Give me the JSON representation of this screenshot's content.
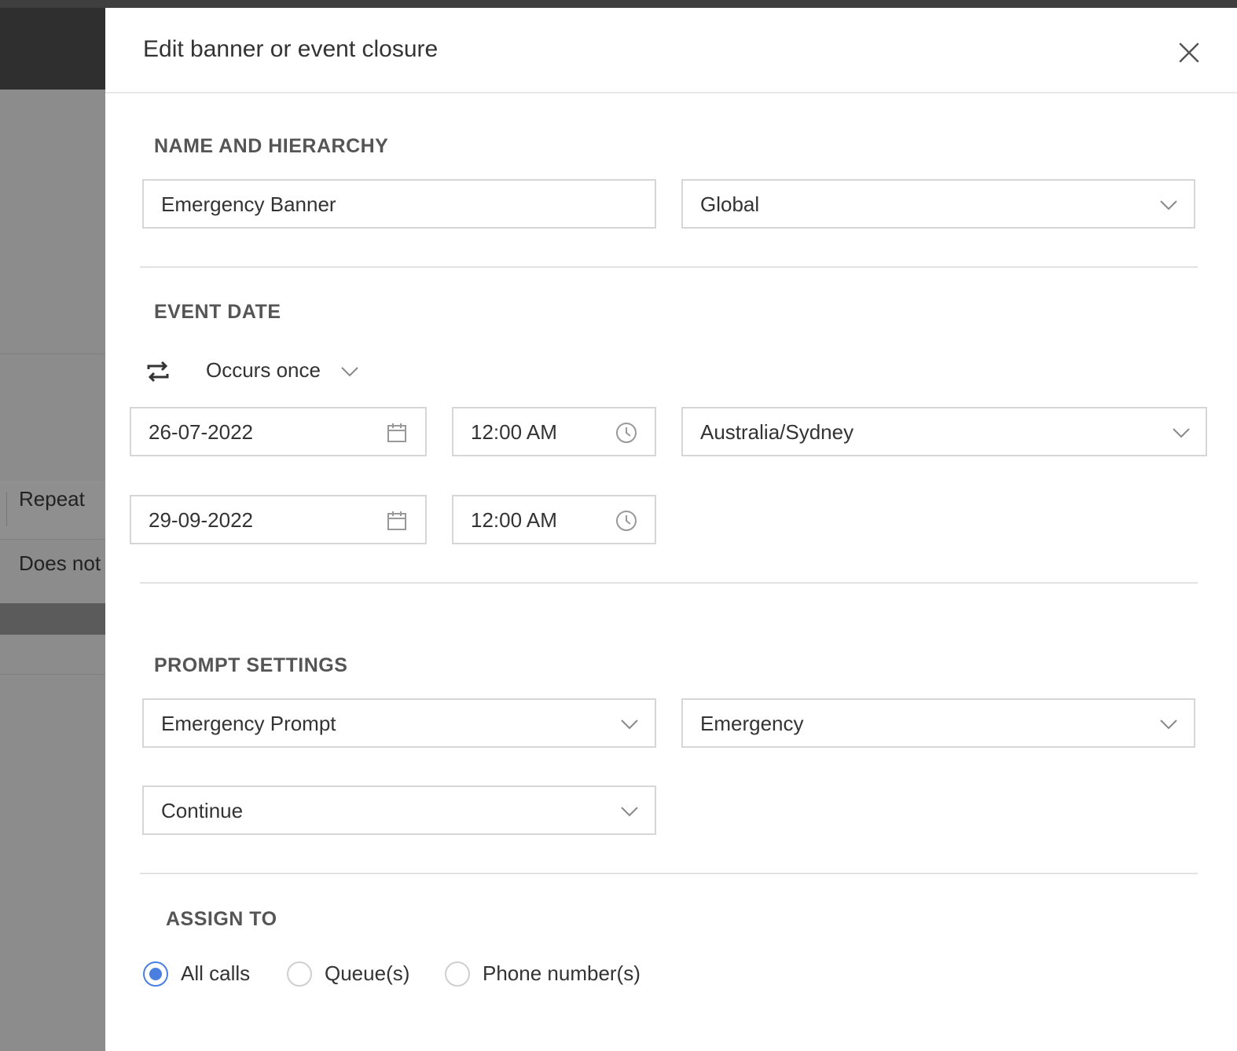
{
  "background": {
    "repeat_label": "Repeat",
    "does_not_label": "Does not"
  },
  "drawer": {
    "title": "Edit banner or event closure"
  },
  "name_hierarchy": {
    "section_title": "NAME AND HIERARCHY",
    "name_value": "Emergency Banner",
    "hierarchy_value": "Global"
  },
  "event_date": {
    "section_title": "EVENT DATE",
    "recurrence_value": "Occurs once",
    "start_date": "26-07-2022",
    "start_time": "12:00 AM",
    "timezone": "Australia/Sydney",
    "end_date": "29-09-2022",
    "end_time": "12:00 AM"
  },
  "prompt_settings": {
    "section_title": "PROMPT SETTINGS",
    "prompt_value": "Emergency Prompt",
    "prompt_type_value": "Emergency",
    "action_value": "Continue"
  },
  "assign_to": {
    "section_title": "ASSIGN TO",
    "options": [
      {
        "label": "All calls",
        "selected": true
      },
      {
        "label": "Queue(s)",
        "selected": false
      },
      {
        "label": "Phone number(s)",
        "selected": false
      }
    ]
  },
  "colors": {
    "radio_accent": "#4a7fe0"
  }
}
